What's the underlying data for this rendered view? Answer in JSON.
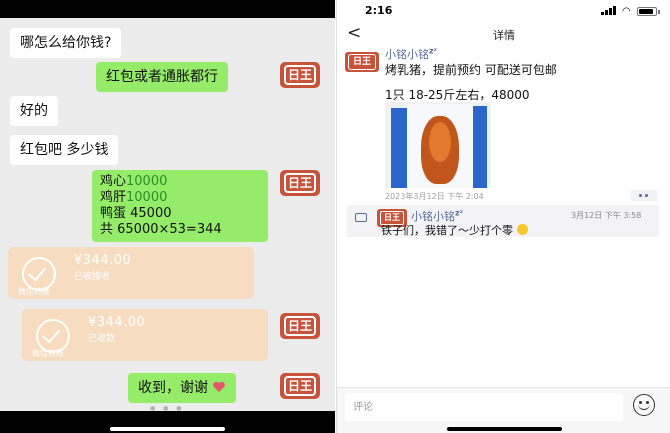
{
  "chat": {
    "avatar_text": "日王",
    "messages": [
      {
        "side": "in",
        "text": "哪怎么给你钱?"
      },
      {
        "side": "out",
        "text": "红包或者通胀都行"
      },
      {
        "side": "in",
        "text": "好的"
      },
      {
        "side": "in",
        "text": "红包吧 多少钱"
      },
      {
        "side": "out",
        "lines": {
          "l1_label": "鸡心",
          "l1_value": "10000",
          "l2_label": "鸡肝",
          "l2_value": "10000",
          "l3": "鸭蛋 45000",
          "l4": "共 65000×53=344"
        }
      },
      {
        "side": "out",
        "text": "收到，谢谢",
        "emoji": "heart-icon"
      }
    ],
    "transfers": [
      {
        "amount": "¥344.00",
        "status": "已被接收",
        "footer": "微信转账"
      },
      {
        "amount": "¥344.00",
        "status": "已收款",
        "footer": "微信转账"
      }
    ]
  },
  "detail": {
    "status_time": "2:16",
    "nav_title": "详情",
    "post": {
      "author": "小铭小铭",
      "avatar_text": "日王",
      "text_line1": "烤乳猪，提前预约 可配送可包邮",
      "text_line2": "1只 18-25斤左右，48000",
      "time": "2023年3月12日 下午 2:04"
    },
    "comment": {
      "author": "小铭小铭",
      "avatar_text": "日王",
      "time": "3月12日 下午 3:58",
      "text": "铁子们，我错了～少打个零"
    },
    "input_placeholder": "评论"
  }
}
